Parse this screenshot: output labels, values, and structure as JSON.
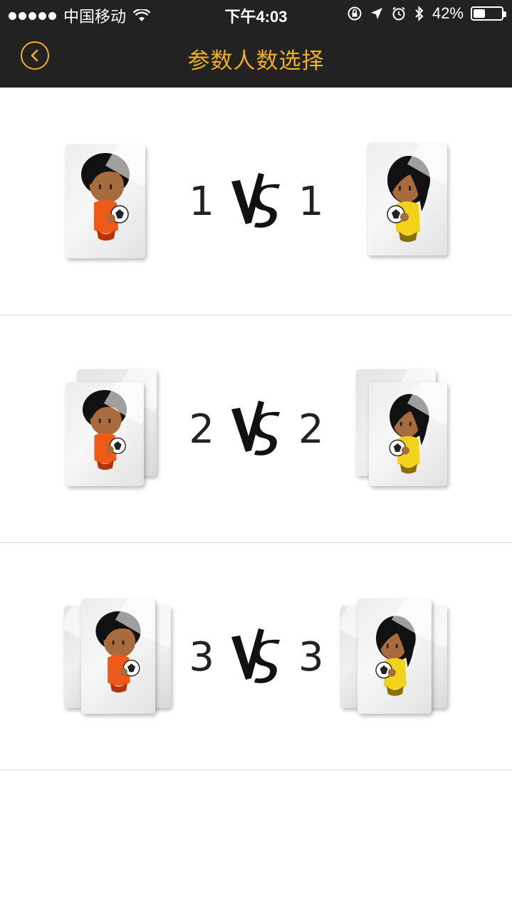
{
  "status_bar": {
    "carrier": "中国移动",
    "time": "下午4:03",
    "battery": "42%",
    "battery_level": 0.42
  },
  "nav": {
    "title": "参数人数选择",
    "back_icon": "chevron-left-icon",
    "accent_color": "#f2b01e",
    "bar_color": "#222222"
  },
  "options": [
    {
      "left": "1",
      "vs": "VS",
      "right": "1"
    },
    {
      "left": "2",
      "vs": "VS",
      "right": "2"
    },
    {
      "left": "3",
      "vs": "VS",
      "right": "3"
    }
  ],
  "team_colors": {
    "left": "#ee5a18",
    "right": "#f2d21a"
  }
}
